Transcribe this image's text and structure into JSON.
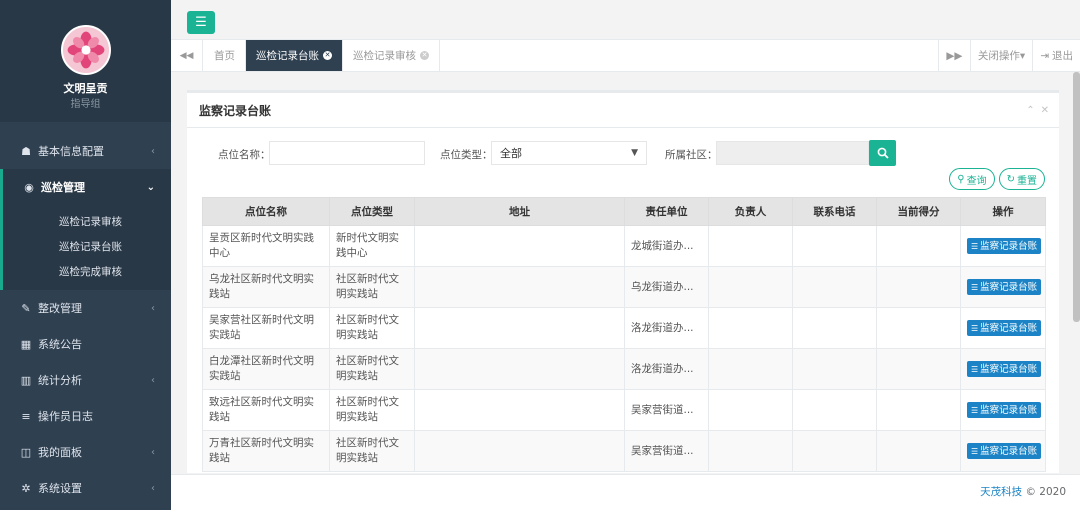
{
  "sidebar": {
    "user_name": "文明呈贡",
    "user_role": "指导组",
    "nav": [
      {
        "label": "基本信息配置",
        "icon": "sitemap-icon",
        "glyph": "☗",
        "chevron": "‹"
      },
      {
        "label": "巡检管理",
        "icon": "eye-icon",
        "glyph": "◉",
        "chevron": "⌄",
        "active": true,
        "children": [
          "巡检记录审核",
          "巡检记录台账",
          "巡检完成审核"
        ]
      },
      {
        "label": "整改管理",
        "icon": "wrench-icon",
        "glyph": "✎",
        "chevron": "‹"
      },
      {
        "label": "系统公告",
        "icon": "grid-icon",
        "glyph": "▦",
        "chevron": ""
      },
      {
        "label": "统计分析",
        "icon": "bar-chart-icon",
        "glyph": "▥",
        "chevron": "‹"
      },
      {
        "label": "操作员日志",
        "icon": "list-icon",
        "glyph": "≡",
        "chevron": ""
      },
      {
        "label": "我的面板",
        "icon": "panel-icon",
        "glyph": "◫",
        "chevron": "‹"
      },
      {
        "label": "系统设置",
        "icon": "gear-icon",
        "glyph": "✲",
        "chevron": "‹"
      }
    ]
  },
  "tabs": {
    "items": [
      {
        "label": "首页",
        "closable": false,
        "active": false
      },
      {
        "label": "巡检记录台账",
        "closable": true,
        "active": true
      },
      {
        "label": "巡检记录审核",
        "closable": true,
        "active": false
      }
    ],
    "close_ops": "关闭操作▾",
    "logout": "退出"
  },
  "panel": {
    "title": "监察记录台账",
    "filters": {
      "name_label": "点位名称：",
      "name_value": "",
      "type_label": "点位类型：",
      "type_value": "全部",
      "community_label": "所属社区：",
      "community_value": ""
    },
    "query_btn": "查询",
    "reset_btn": "重置"
  },
  "table": {
    "headers": [
      "点位名称",
      "点位类型",
      "地址",
      "责任单位",
      "负责人",
      "联系电话",
      "当前得分",
      "操作"
    ],
    "row_action": "监察记录台账",
    "rows": [
      {
        "name": "呈贡区新时代文明实践中心",
        "type": "新时代文明实践中心",
        "addr": "",
        "unit": "龙城街道办...",
        "owner": "",
        "phone": "",
        "score": ""
      },
      {
        "name": "乌龙社区新时代文明实践站",
        "type": "社区新时代文明实践站",
        "addr": "",
        "unit": "乌龙街道办...",
        "owner": "",
        "phone": "",
        "score": ""
      },
      {
        "name": "吴家营社区新时代文明实践站",
        "type": "社区新时代文明实践站",
        "addr": "",
        "unit": "洛龙街道办...",
        "owner": "",
        "phone": "",
        "score": ""
      },
      {
        "name": "白龙潭社区新时代文明实践站",
        "type": "社区新时代文明实践站",
        "addr": "",
        "unit": "洛龙街道办...",
        "owner": "",
        "phone": "",
        "score": ""
      },
      {
        "name": "致远社区新时代文明实践站",
        "type": "社区新时代文明实践站",
        "addr": "",
        "unit": "吴家营街道...",
        "owner": "",
        "phone": "",
        "score": ""
      },
      {
        "name": "万青社区新时代文明实践站",
        "type": "社区新时代文明实践站",
        "addr": "",
        "unit": "吴家营街道...",
        "owner": "",
        "phone": "",
        "score": ""
      }
    ]
  },
  "footer": {
    "brand": "天茂科技",
    "copyright": "© 2020"
  }
}
